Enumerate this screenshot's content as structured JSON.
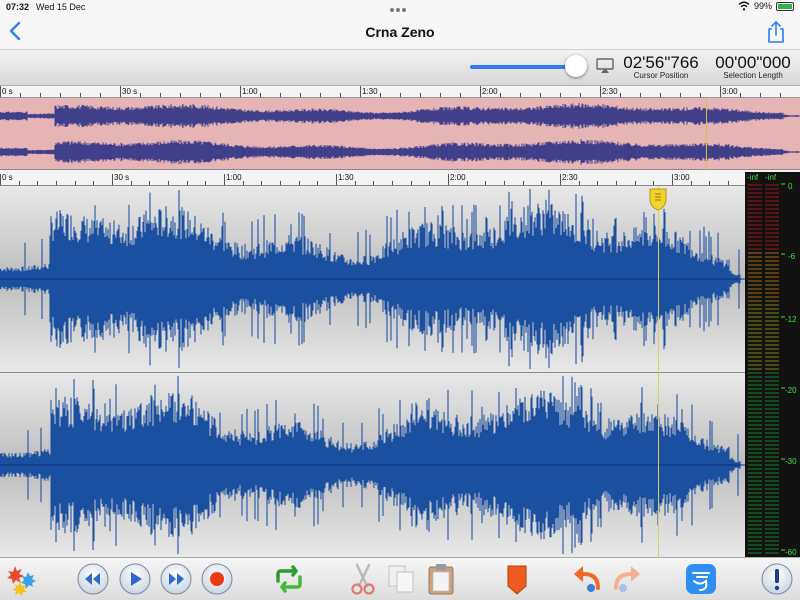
{
  "status": {
    "time": "07:32",
    "date": "Wed 15 Dec",
    "battery": "99%"
  },
  "nav": {
    "title": "Crna Zeno"
  },
  "info": {
    "cursor_position": "02'56\"766",
    "cursor_caption": "Cursor Position",
    "selection_length": "00'00\"000",
    "selection_caption": "Selection Length",
    "volume": 0.87
  },
  "overview_ruler": [
    "0 s",
    "30 s",
    "1:00",
    "1:30",
    "2:00",
    "2:30",
    "3:00"
  ],
  "main_ruler": [
    "0 s",
    "30 s",
    "1:00",
    "1:30",
    "2:00",
    "2:30",
    "3:00"
  ],
  "meter": {
    "top_left": "-inf",
    "top_right": "-inf",
    "scale": [
      "0",
      "-6",
      "-12",
      "-20",
      "-30",
      "-60"
    ]
  },
  "colors": {
    "waveform": "#1b4fa0",
    "overview_bg": "#e6b4b4",
    "accent": "#3478f6",
    "meter_text": "#3de03d"
  },
  "toolbar": {
    "tools": [
      "effects-icon",
      "rewind-icon",
      "play-icon",
      "fast-forward-icon",
      "record-icon",
      "loop-icon",
      "cut-icon",
      "copy-icon",
      "paste-icon",
      "marker-icon",
      "undo-icon",
      "redo-icon",
      "processing-icon",
      "info-icon"
    ]
  }
}
